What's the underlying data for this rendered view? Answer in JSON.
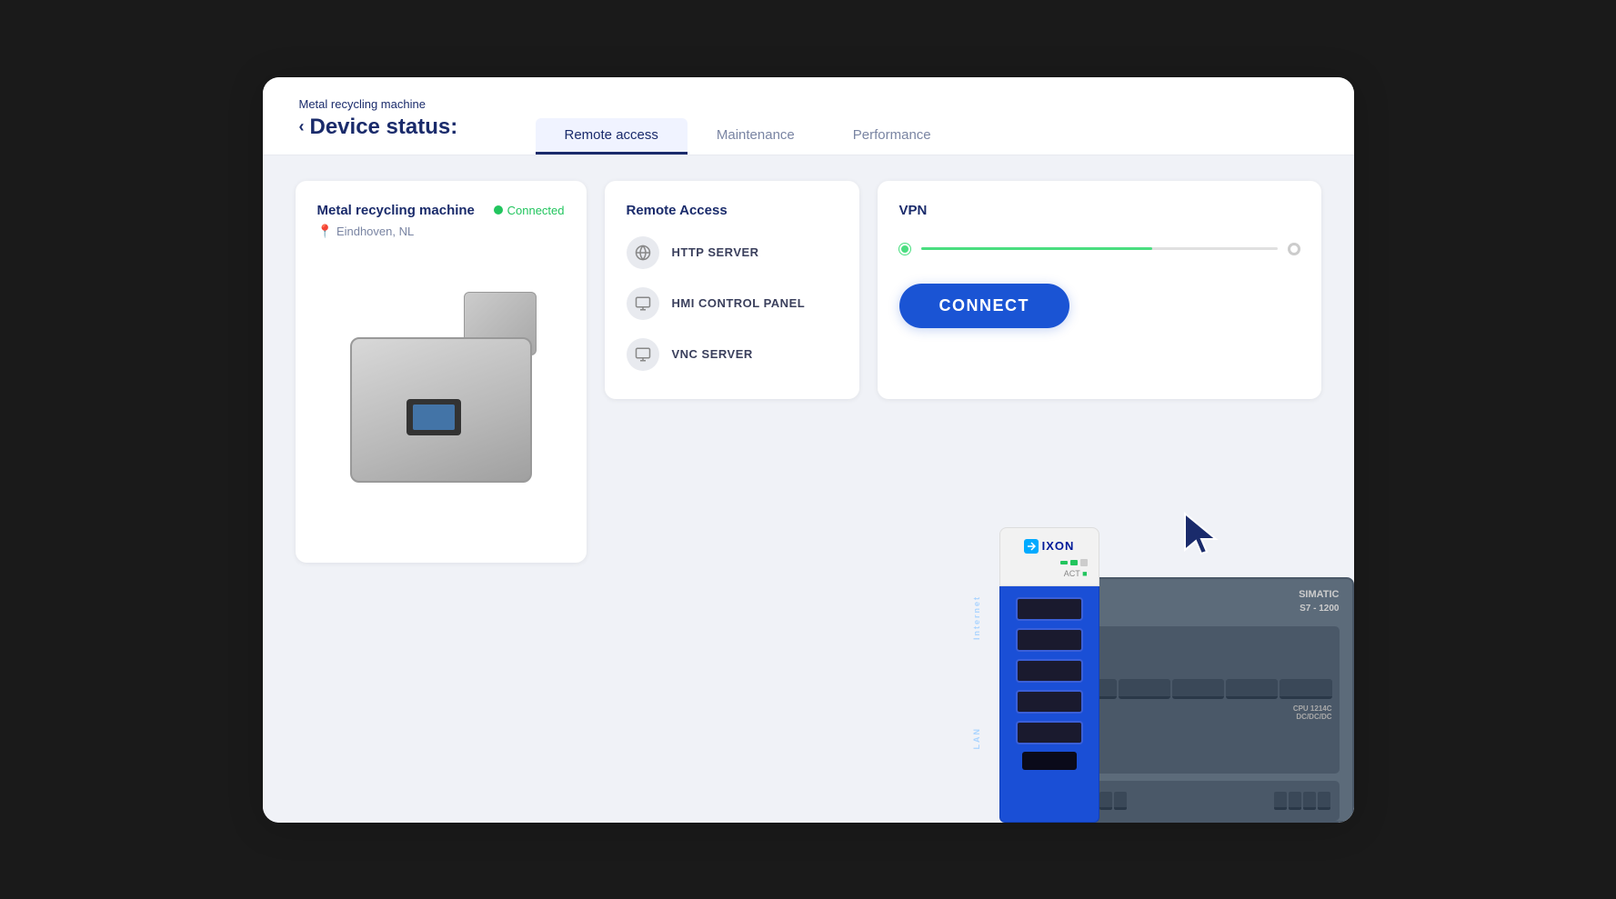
{
  "header": {
    "breadcrumb": "Metal recycling machine",
    "back_label": "‹",
    "title": "Device status:",
    "tabs": [
      {
        "id": "remote-access",
        "label": "Remote access",
        "active": true
      },
      {
        "id": "maintenance",
        "label": "Maintenance",
        "active": false
      },
      {
        "id": "performance",
        "label": "Performance",
        "active": false
      }
    ]
  },
  "device_card": {
    "name": "Metal recycling machine",
    "status": "Connected",
    "location": "Eindhoven, NL"
  },
  "remote_access_card": {
    "title": "Remote Access",
    "items": [
      {
        "id": "http-server",
        "label": "HTTP SERVER"
      },
      {
        "id": "hmi-panel",
        "label": "HMI CONTROL PANEL"
      },
      {
        "id": "vnc-server",
        "label": "VNC SERVER"
      }
    ]
  },
  "vpn_card": {
    "title": "VPN",
    "connect_label": "CONNECT"
  },
  "colors": {
    "primary": "#1a2b6b",
    "accent": "#1a54d4",
    "connected_green": "#22c55e",
    "slider_green": "#4ade80"
  }
}
